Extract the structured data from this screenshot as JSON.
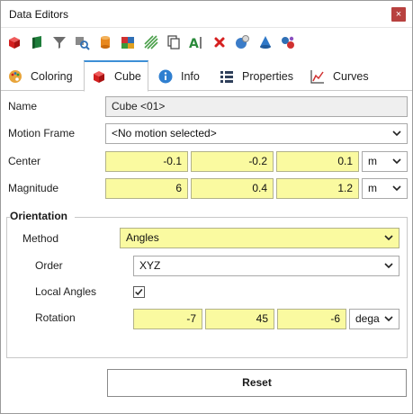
{
  "window": {
    "title": "Data Editors",
    "close_glyph": "×"
  },
  "toolbar": {
    "icons": [
      "red-cube-icon",
      "green-flag-icon",
      "funnel-icon",
      "search-box-icon",
      "cylinder-icon",
      "multi-cube-icon",
      "hatch-lines-icon",
      "copy-icon",
      "text-cursor-icon",
      "delete-x-icon",
      "gear-sphere-icon",
      "cone-icon",
      "molecule-icon"
    ]
  },
  "tabs": [
    {
      "label": "Coloring",
      "icon": "palette-icon",
      "active": false
    },
    {
      "label": "Cube",
      "icon": "red-cube-icon",
      "active": true
    },
    {
      "label": "Info",
      "icon": "info-icon",
      "active": false
    },
    {
      "label": "Properties",
      "icon": "grid-icon",
      "active": false
    },
    {
      "label": "Curves",
      "icon": "chart-curve-icon",
      "active": false
    }
  ],
  "form": {
    "name_label": "Name",
    "name_value": "Cube <01>",
    "motion_label": "Motion Frame",
    "motion_value": "<No motion selected>",
    "center_label": "Center",
    "center_x": "-0.1",
    "center_y": "-0.2",
    "center_z": "0.1",
    "center_unit": "m",
    "magnitude_label": "Magnitude",
    "magnitude_x": "6",
    "magnitude_y": "0.4",
    "magnitude_z": "1.2",
    "magnitude_unit": "m"
  },
  "orientation": {
    "group_title": "Orientation",
    "method_label": "Method",
    "method_value": "Angles",
    "order_label": "Order",
    "order_value": "XYZ",
    "local_label": "Local Angles",
    "local_checked": true,
    "rotation_label": "Rotation",
    "rot_x": "-7",
    "rot_y": "45",
    "rot_z": "-6",
    "rot_unit": "dega"
  },
  "buttons": {
    "reset": "Reset"
  },
  "colors": {
    "accent": "#3d8fd6",
    "highlight": "#fafaa0",
    "close": "#b8413f"
  }
}
